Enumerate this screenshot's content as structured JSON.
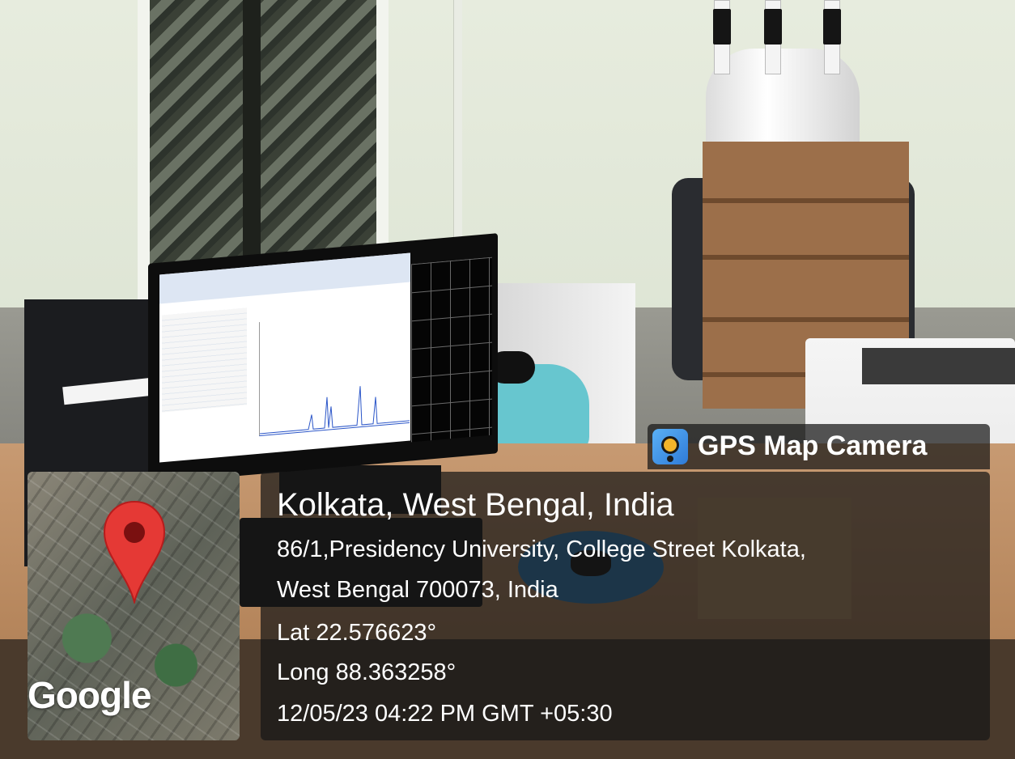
{
  "watermark": {
    "app_name": "GPS Map Camera",
    "map_attribution": "Google"
  },
  "location": {
    "title": "Kolkata, West Bengal, India",
    "address_line_1": "86/1,Presidency University, College Street Kolkata,",
    "address_line_2": "West Bengal 700073, India",
    "latitude": "Lat 22.576623°",
    "longitude": "Long 88.363258°",
    "datetime": "12/05/23 04:22 PM GMT +05:30"
  },
  "icons": {
    "map_pin": "location-pin-icon",
    "app_logo": "camera-pin-icon"
  },
  "colors": {
    "overlay": "#161616",
    "pin": "#e53935",
    "pin_center": "#7a1010",
    "text": "#ffffff"
  }
}
